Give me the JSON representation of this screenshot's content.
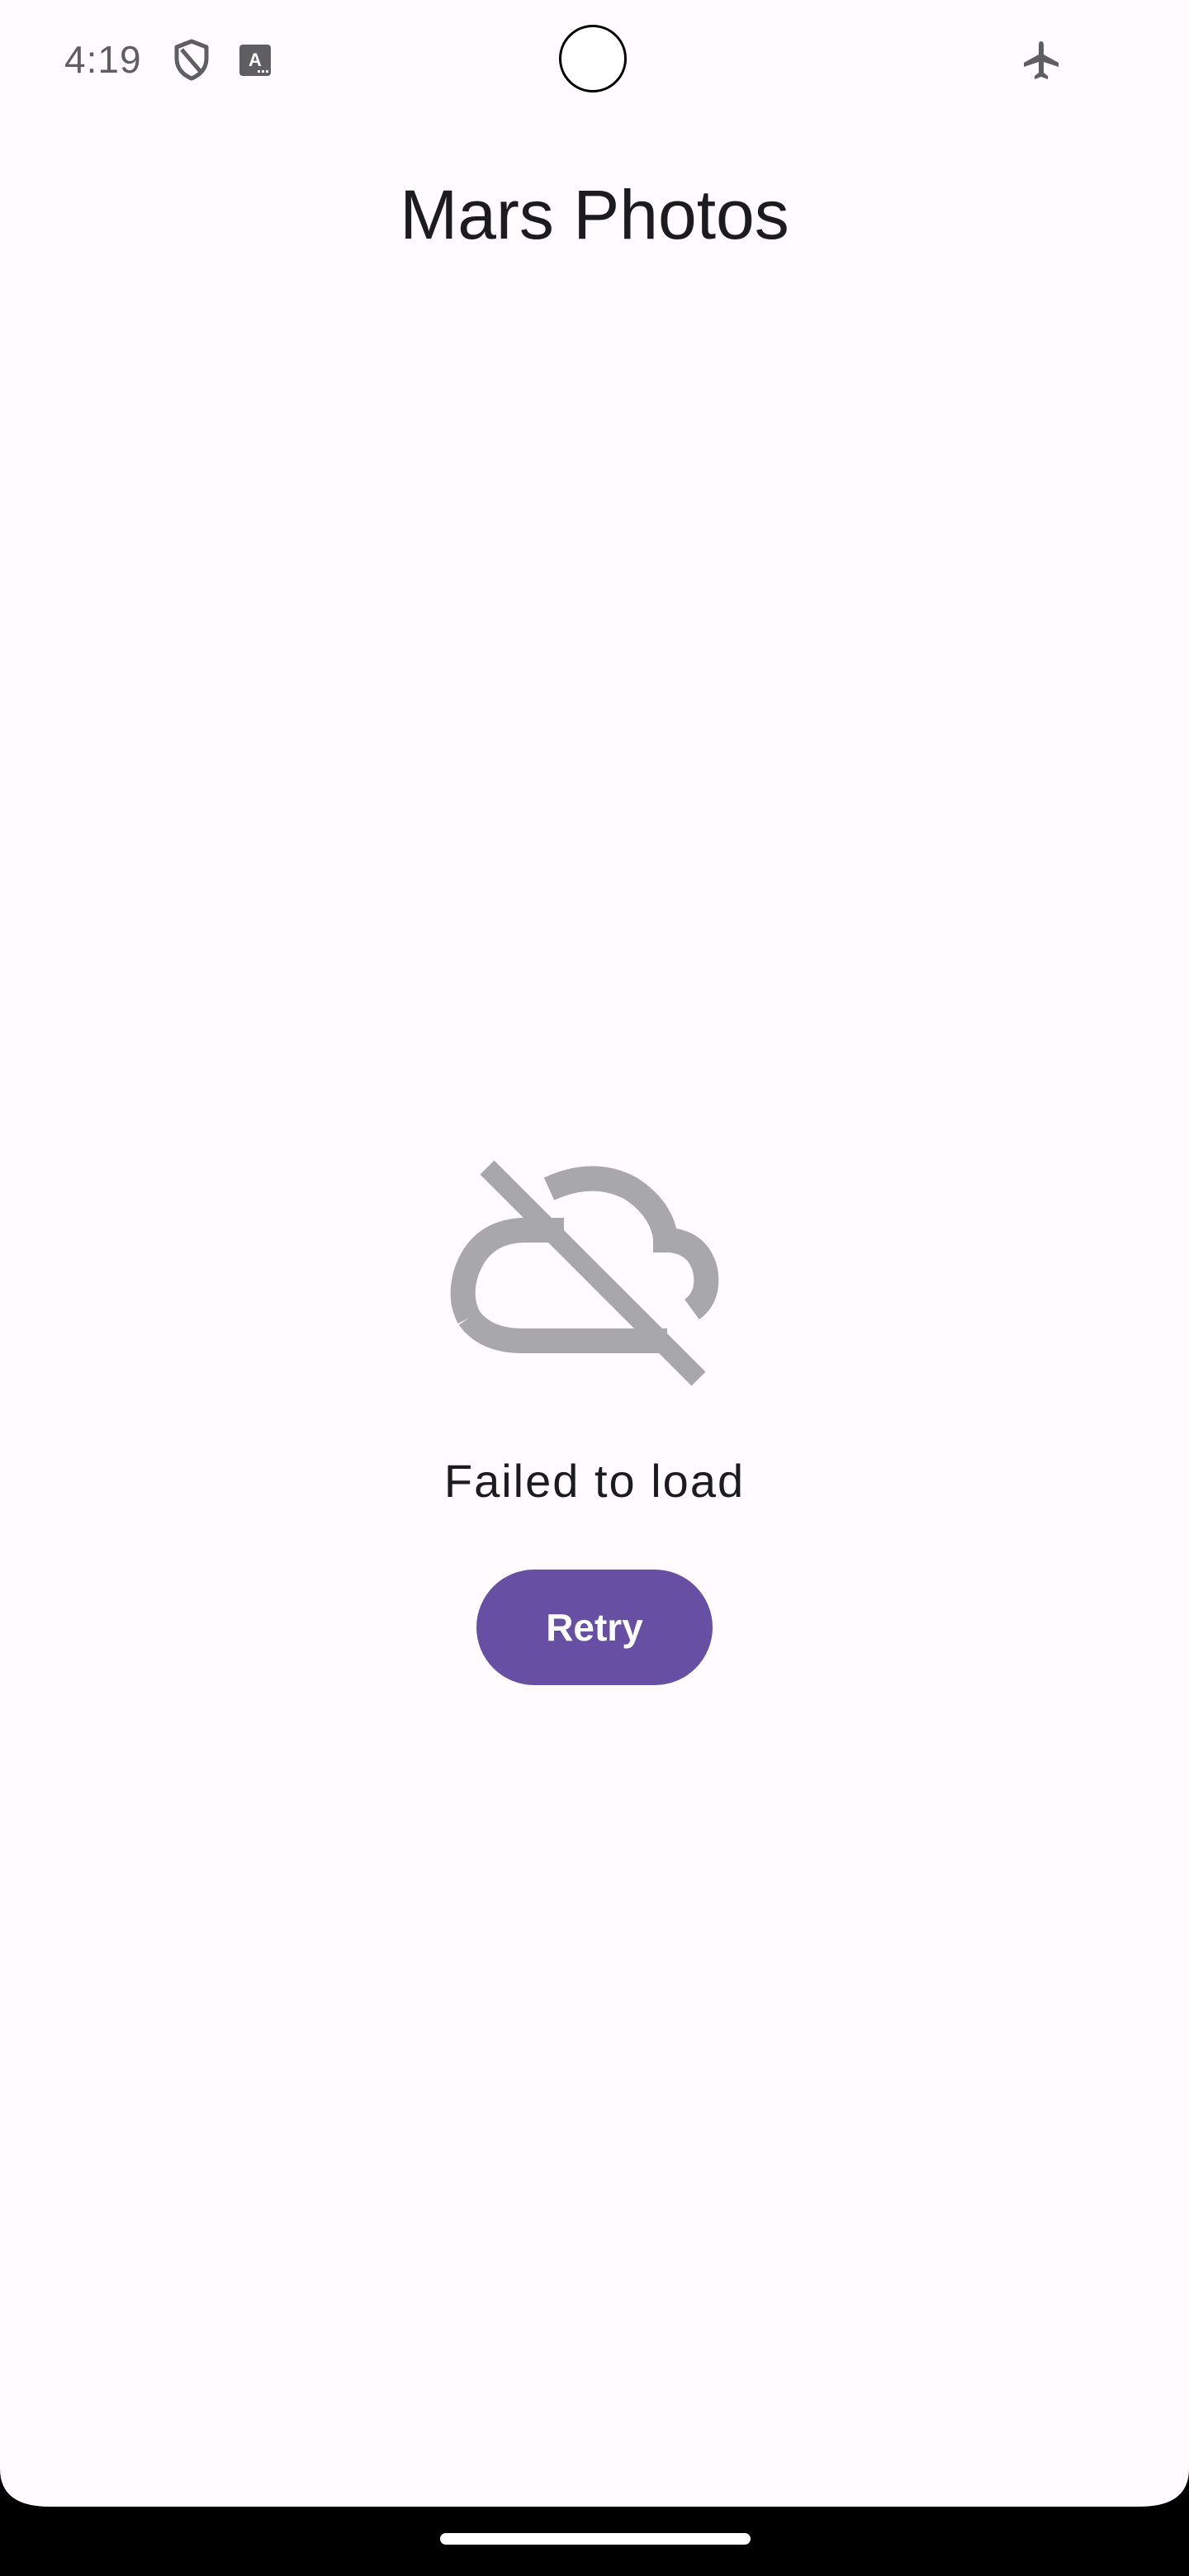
{
  "status_bar": {
    "time": "4:19",
    "icons": [
      "shield-icon",
      "keyboard-a-icon",
      "airplane-mode-icon"
    ]
  },
  "app": {
    "title": "Mars Photos"
  },
  "error_state": {
    "icon": "cloud-off-icon",
    "message": "Failed to load",
    "retry_label": "Retry"
  },
  "colors": {
    "background": "#fffbfe",
    "primary": "#6750a4",
    "on_primary": "#ffffff",
    "icon_gray": "#a8a8aa",
    "text": "#1c1b1f"
  }
}
